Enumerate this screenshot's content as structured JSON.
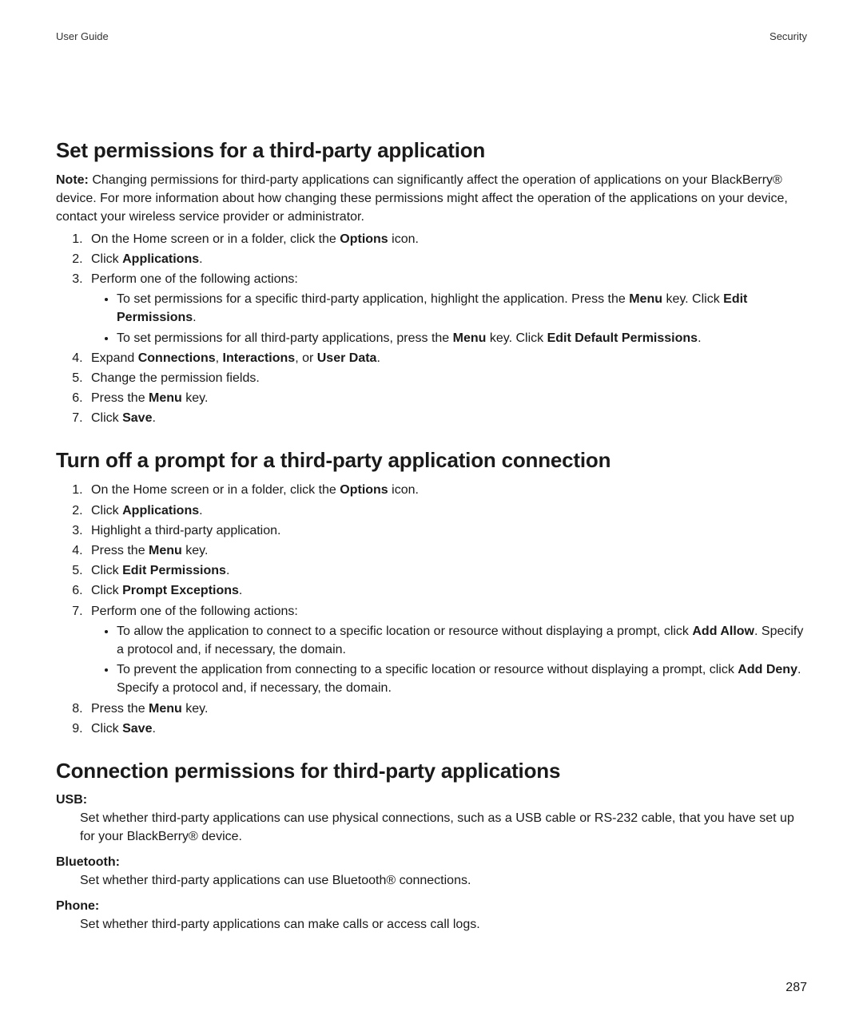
{
  "header": {
    "left": "User Guide",
    "right": "Security"
  },
  "section1": {
    "title": "Set permissions for a third-party application",
    "note_bold": "Note:",
    "note_text": "  Changing permissions for third-party applications can significantly affect the operation of applications on your BlackBerry® device. For more information about how changing these permissions might affect the operation of the applications on your device, contact your wireless service provider or administrator.",
    "step1_a": "On the Home screen or in a folder, click the ",
    "step1_b": "Options",
    "step1_c": " icon.",
    "step2_a": "Click ",
    "step2_b": "Applications",
    "step2_c": ".",
    "step3": "Perform one of the following actions:",
    "step3_bullet1_a": "To set permissions for a specific third-party application, highlight the application. Press the ",
    "step3_bullet1_b": "Menu",
    "step3_bullet1_c": " key. Click ",
    "step3_bullet1_d": "Edit Permissions",
    "step3_bullet1_e": ".",
    "step3_bullet2_a": "To set permissions for all third-party applications, press the ",
    "step3_bullet2_b": "Menu",
    "step3_bullet2_c": " key. Click ",
    "step3_bullet2_d": "Edit Default Permissions",
    "step3_bullet2_e": ".",
    "step4_a": "Expand ",
    "step4_b": "Connections",
    "step4_c": ", ",
    "step4_d": "Interactions",
    "step4_e": ", or ",
    "step4_f": "User Data",
    "step4_g": ".",
    "step5": "Change the permission fields.",
    "step6_a": "Press the ",
    "step6_b": "Menu",
    "step6_c": " key.",
    "step7_a": "Click ",
    "step7_b": "Save",
    "step7_c": "."
  },
  "section2": {
    "title": "Turn off a prompt for a third-party application connection",
    "step1_a": "On the Home screen or in a folder, click the ",
    "step1_b": "Options",
    "step1_c": " icon.",
    "step2_a": "Click ",
    "step2_b": "Applications",
    "step2_c": ".",
    "step3": "Highlight a third-party application.",
    "step4_a": "Press the ",
    "step4_b": "Menu",
    "step4_c": " key.",
    "step5_a": "Click ",
    "step5_b": "Edit Permissions",
    "step5_c": ".",
    "step6_a": "Click ",
    "step6_b": "Prompt Exceptions",
    "step6_c": ".",
    "step7": "Perform one of the following actions:",
    "step7_bullet1_a": "To allow the application to connect to a specific location or resource without displaying a prompt, click ",
    "step7_bullet1_b": "Add Allow",
    "step7_bullet1_c": ". Specify a protocol and, if necessary, the domain.",
    "step7_bullet2_a": "To prevent the application from connecting to a specific location or resource without displaying a prompt, click ",
    "step7_bullet2_b": "Add Deny",
    "step7_bullet2_c": ". Specify a protocol and, if necessary, the domain.",
    "step8_a": "Press the ",
    "step8_b": "Menu",
    "step8_c": " key.",
    "step9_a": "Click ",
    "step9_b": "Save",
    "step9_c": "."
  },
  "section3": {
    "title": "Connection permissions for third-party applications",
    "usb_label": "USB:",
    "usb_text": "Set whether third-party applications can use physical connections, such as a USB cable or RS-232 cable, that you have set up for your BlackBerry® device.",
    "bt_label": "Bluetooth:",
    "bt_text": "Set whether third-party applications can use Bluetooth® connections.",
    "phone_label": "Phone:",
    "phone_text": "Set whether third-party applications can make calls or access call logs."
  },
  "page_number": "287"
}
